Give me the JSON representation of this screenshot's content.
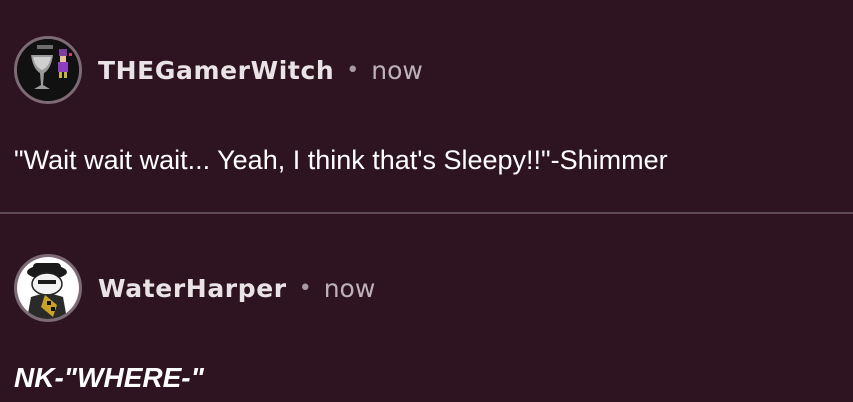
{
  "comments": [
    {
      "username": "THEGamerWitch",
      "separator": "•",
      "time": "now",
      "text": "\"Wait wait wait... Yeah, I think that's Sleepy!!\"-Shimmer",
      "avatar_icon": "goblet-witch-avatar"
    },
    {
      "username": "WaterHarper",
      "separator": "•",
      "time": "now",
      "text": "NK-\"WHERE-\"",
      "avatar_icon": "hatted-character-avatar"
    }
  ],
  "colors": {
    "background": "#2e1421",
    "divider": "#5e4a55",
    "username": "#e9e3e6",
    "timestamp": "#bdb2b8"
  }
}
